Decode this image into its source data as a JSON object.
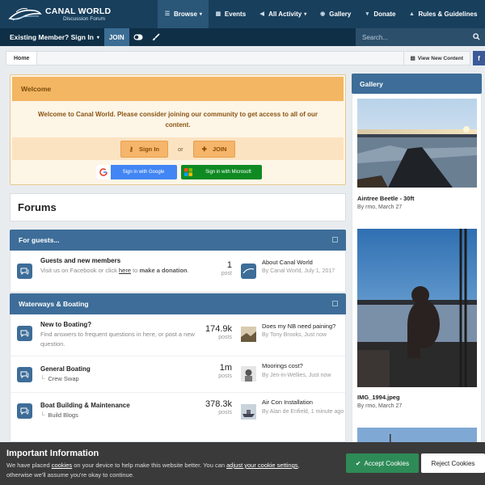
{
  "header": {
    "logo_title": "CANAL WORLD",
    "logo_subtitle": "Discussion Forum",
    "nav": [
      {
        "label": "Browse",
        "icon": "list-icon",
        "active": true
      },
      {
        "label": "Events",
        "icon": "calendar-icon"
      },
      {
        "label": "All Activity",
        "icon": "megaphone-icon"
      },
      {
        "label": "Gallery",
        "icon": "camera-icon"
      },
      {
        "label": "Donate",
        "icon": "cart-icon"
      },
      {
        "label": "Rules & Guidelines",
        "icon": "warning-icon"
      }
    ]
  },
  "userbar": {
    "signin_label": "Existing Member? Sign In",
    "join_label": "JOIN",
    "search_placeholder": "Search..."
  },
  "breadcrumb": {
    "home": "Home",
    "view_new_content": "View New Content",
    "facebook": "f"
  },
  "welcome": {
    "heading": "Welcome",
    "message": "Welcome to Canal World. Please consider joining our community to get access to all of our content.",
    "signin_label": "Sign In",
    "or_label": "or",
    "join_label": "JOIN",
    "google_label": "Sign in with Google",
    "microsoft_label": "Sign in with Microsoft"
  },
  "page_title": "Forums",
  "categories": [
    {
      "title": "For guests...",
      "forums": [
        {
          "title": "Guests and new members",
          "desc_parts": [
            "Visit us on Facebook or click ",
            "here",
            " to ",
            "make a donation",
            "."
          ],
          "count": "1",
          "count_label": "post",
          "last_title": "About Canal World",
          "last_by": "By Canal World, July 1, 2017"
        }
      ]
    },
    {
      "title": "Waterways & Boating",
      "forums": [
        {
          "title": "New to Boating?",
          "desc": "Find answers to frequent questions in here, or post a new question.",
          "count": "174.9k",
          "count_label": "posts",
          "last_title": "Does my NB need paining?",
          "last_by": "By Tony Brooks, Just now"
        },
        {
          "title": "General Boating",
          "sub": "Crew Swap",
          "count": "1m",
          "count_label": "posts",
          "last_title": "Moorings cost?",
          "last_by": "By Jen-in-Wellies, Just now"
        },
        {
          "title": "Boat Building & Maintenance",
          "sub": "Build Blogs",
          "count": "378.3k",
          "count_label": "posts",
          "last_title": "Air Con Installation",
          "last_by": "By Alan de Enfield, 1 minute ago"
        }
      ]
    }
  ],
  "gallery": {
    "heading": "Gallery",
    "items": [
      {
        "title": "Aintree Beetle - 30ft",
        "by": "By rmo, March 27"
      },
      {
        "title": "IMG_1994.jpeg",
        "by": "By rmo, March 27"
      }
    ]
  },
  "cookie": {
    "title": "Important Information",
    "text_parts": [
      "We have placed ",
      "cookies",
      " on your device to help make this website better. You can ",
      "adjust your cookie settings",
      ", otherwise we'll assume you're okay to continue."
    ],
    "accept_label": "Accept Cookies",
    "reject_label": "Reject Cookies"
  },
  "colors": {
    "header_bg": "#183f5c",
    "category_bg": "#3d6d98",
    "welcome_bg": "#f3b663",
    "accept_bg": "#2e8b57"
  }
}
